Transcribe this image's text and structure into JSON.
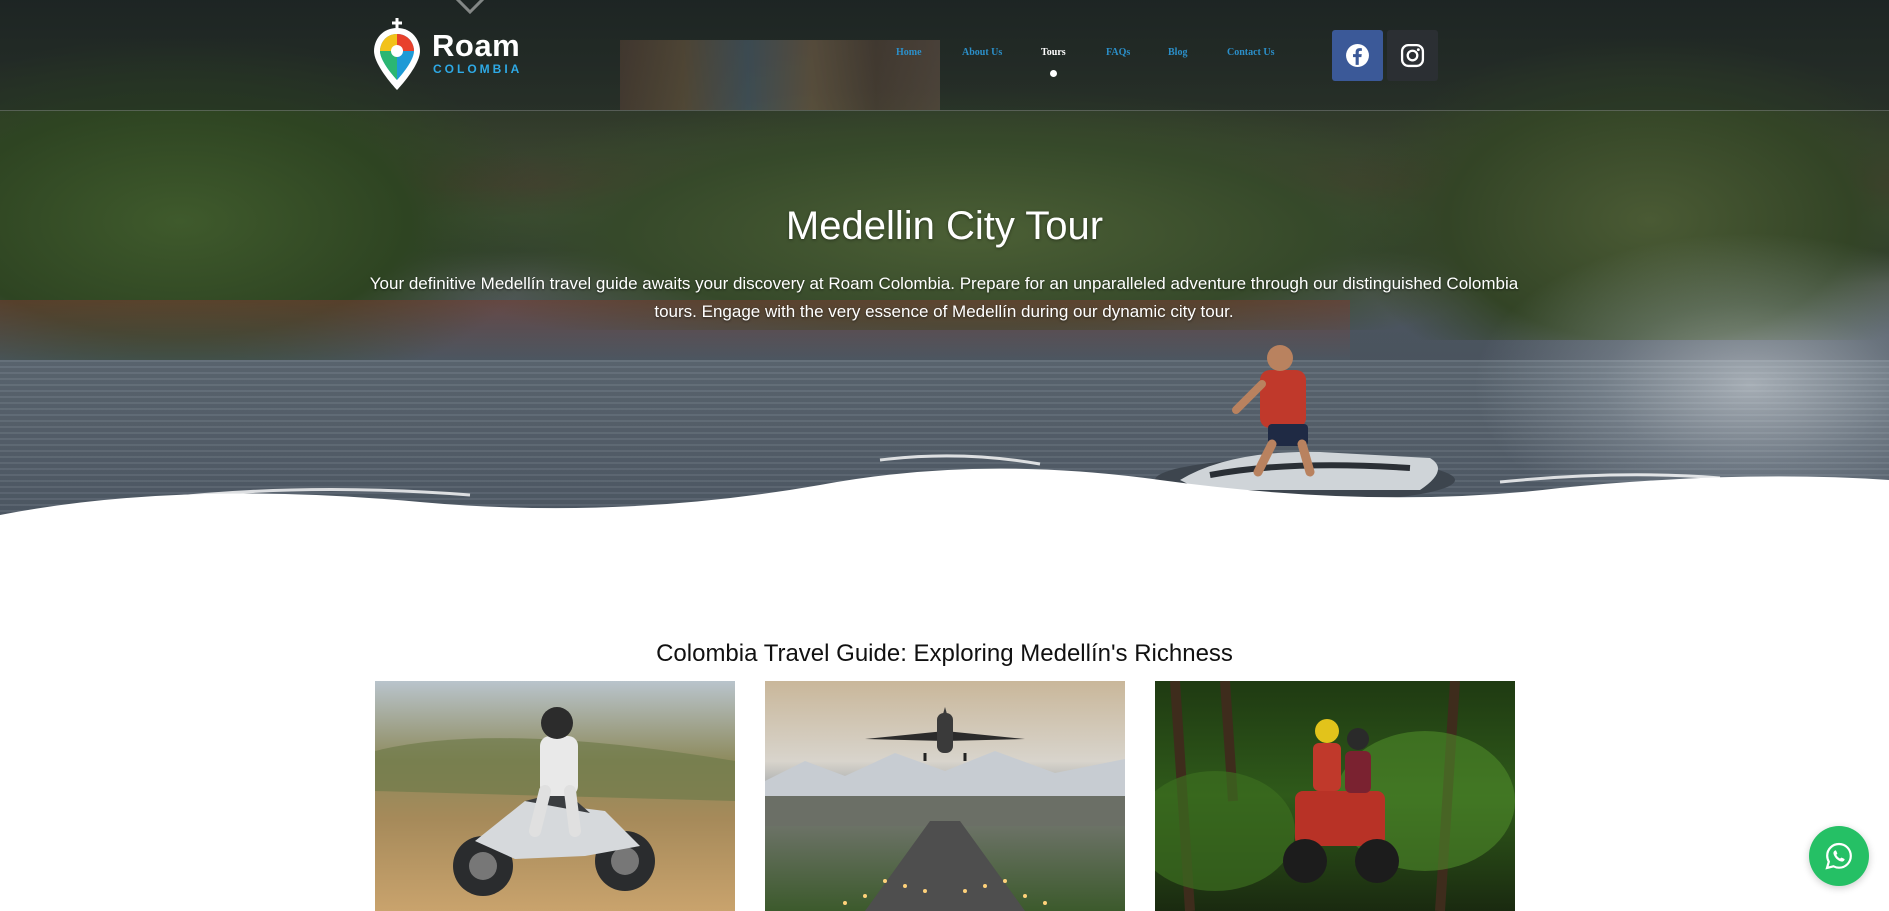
{
  "header": {
    "logo_word": "Roam",
    "logo_sub": "COLOMBIA",
    "nav": [
      {
        "label": "Home",
        "active": false
      },
      {
        "label": "About Us",
        "active": false
      },
      {
        "label": "Tours",
        "active": true
      },
      {
        "label": "FAQs",
        "active": false
      },
      {
        "label": "Blog",
        "active": false
      },
      {
        "label": "Contact Us",
        "active": false
      }
    ],
    "social": [
      {
        "name": "facebook-icon",
        "color": "#3b5998"
      },
      {
        "name": "instagram-icon",
        "color": "#2b2f33"
      }
    ]
  },
  "hero": {
    "title": "Medellin City Tour",
    "subtitle": "Your definitive Medellín travel guide awaits your discovery at Roam Colombia. Prepare for an unparalleled adventure through our distinguished Colombia tours. Engage with the very essence of Medellín during our dynamic city tour."
  },
  "section": {
    "title": "Colombia Travel Guide: Exploring Medellín's Richness",
    "cards": [
      {
        "image": "motorcycle-photo"
      },
      {
        "image": "airplane-landing-photo"
      },
      {
        "image": "atv-forest-photo"
      }
    ]
  },
  "colors": {
    "accent": "#2ea9e5",
    "nav_link": "#2b8fc9",
    "facebook": "#3b5998",
    "whatsapp": "#25c065"
  },
  "floating": {
    "icon": "whatsapp-icon"
  }
}
